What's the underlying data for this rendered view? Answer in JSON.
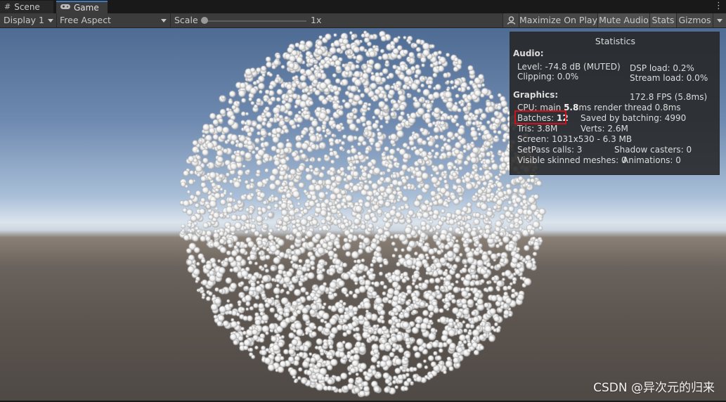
{
  "tabs": {
    "scene": "Scene",
    "game": "Game"
  },
  "tab_icons": {
    "scene": "grid-icon",
    "game": "gamepad-icon"
  },
  "toolbar": {
    "display": "Display 1",
    "aspect": "Free Aspect",
    "scale_label": "Scale",
    "scale_value": "1x",
    "maximize": "Maximize On Play",
    "mute": "Mute Audio",
    "stats": "Stats",
    "gizmos": "Gizmos"
  },
  "stats": {
    "title": "Statistics",
    "audio_header": "Audio:",
    "level": "Level: -74.8 dB (MUTED)",
    "clipping": "Clipping: 0.0%",
    "dsp_load": "DSP load: 0.2%",
    "stream_load": "Stream load: 0.0%",
    "graphics_header": "Graphics:",
    "fps": "172.8 FPS (5.8ms)",
    "cpu_prefix": "CPU: main ",
    "cpu_main": "5.8",
    "cpu_suffix": "ms  render thread 0.8ms",
    "batches_prefix": "Batches: ",
    "batches_value": "12",
    "saved_by_batching": "Saved by batching: 4990",
    "tris": "Tris: 3.8M",
    "verts": "Verts: 2.6M",
    "screen": "Screen: 1031x530 - 6.3 MB",
    "setpass": "SetPass calls: 3",
    "shadow_casters": "Shadow casters: 0",
    "skinned": "Visible skinned meshes: 0",
    "animations": "Animations: 0"
  },
  "watermark": "CSDN @异次元的归来",
  "colors": {
    "accent": "#3a79bb",
    "highlight": "#d0101a"
  }
}
